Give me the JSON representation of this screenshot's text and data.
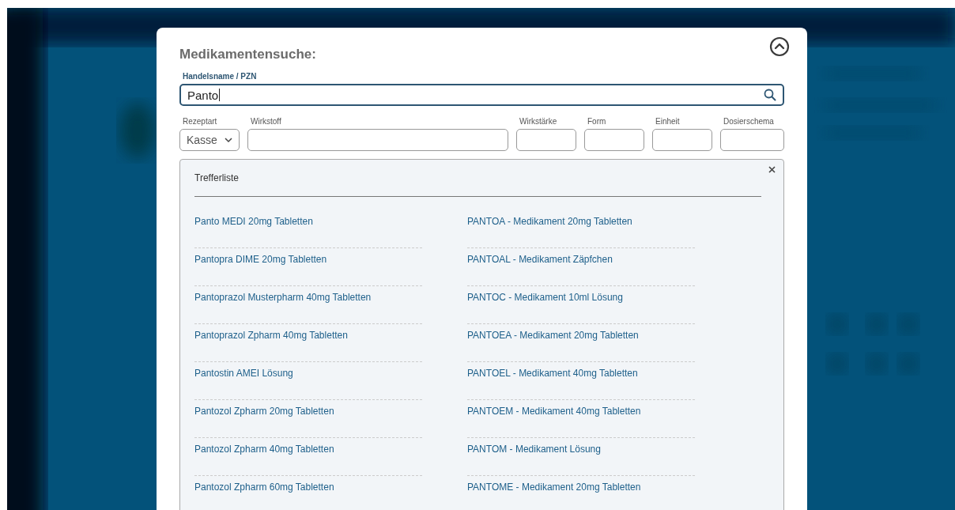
{
  "dialog": {
    "title": "Medikamentensuche:"
  },
  "search": {
    "label": "Handelsname / PZN",
    "value": "Panto"
  },
  "filters": [
    {
      "kind": "select",
      "label": "Rezeptart",
      "value": "Kasse"
    },
    {
      "kind": "text",
      "label": "Wirkstoff"
    },
    {
      "kind": "text",
      "label": "Wirkstärke"
    },
    {
      "kind": "text",
      "label": "Form"
    },
    {
      "kind": "text",
      "label": "Einheit"
    },
    {
      "kind": "text",
      "label": "Dosierschema"
    }
  ],
  "results": {
    "title": "Trefferliste",
    "columns": [
      [
        "Panto MEDI 20mg Tabletten",
        "Pantopra DIME 20mg Tabletten",
        "Pantoprazol Musterpharm 40mg Tabletten",
        "Pantoprazol Zpharm 40mg Tabletten",
        "Pantostin AMEI Lösung",
        "Pantozol Zpharm 20mg Tabletten",
        "Pantozol Zpharm 40mg Tabletten",
        "Pantozol Zpharm 60mg Tabletten"
      ],
      [
        "PANTOA - Medikament 20mg Tabletten",
        "PANTOAL - Medikament Zäpfchen",
        "PANTOC - Medikament 10ml Lösung",
        "PANTOEA - Medikament 20mg Tabletten",
        "PANTOEL - Medikament 40mg Tabletten",
        "PANTOEM - Medikament 40mg Tabletten",
        "PANTOM - Medikament Lösung",
        "PANTOME - Medikament 20mg Tabletten"
      ]
    ]
  }
}
